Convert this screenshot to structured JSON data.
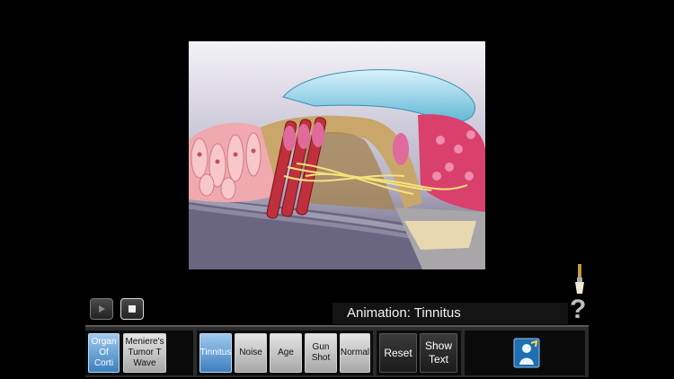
{
  "animation_label": "Animation: Tinnitus",
  "help_icon": "question-mark-icon",
  "brush_icon": "paintbrush-icon",
  "media_controls": {
    "play_icon": "play-icon",
    "stop_icon": "stop-icon"
  },
  "toolbar": {
    "scenes": [
      {
        "label": "Organ Of Corti",
        "selected": true
      },
      {
        "label": "Meniere's Tumor T Wave",
        "selected": false
      }
    ],
    "animations": [
      {
        "label": "Tinnitus",
        "selected": true
      },
      {
        "label": "Noise",
        "selected": false
      },
      {
        "label": "Age",
        "selected": false
      },
      {
        "label": "Gun Shot",
        "selected": false
      },
      {
        "label": "Normal",
        "selected": false
      }
    ],
    "reset_label": "Reset",
    "show_text_label": "Show Text",
    "app_icon": "app-icon"
  },
  "colors": {
    "selected_button": "#3c7fc0",
    "membrane": "#8fd3e6",
    "tissue": "#e89aa0",
    "nerve": "#f3e37a"
  }
}
